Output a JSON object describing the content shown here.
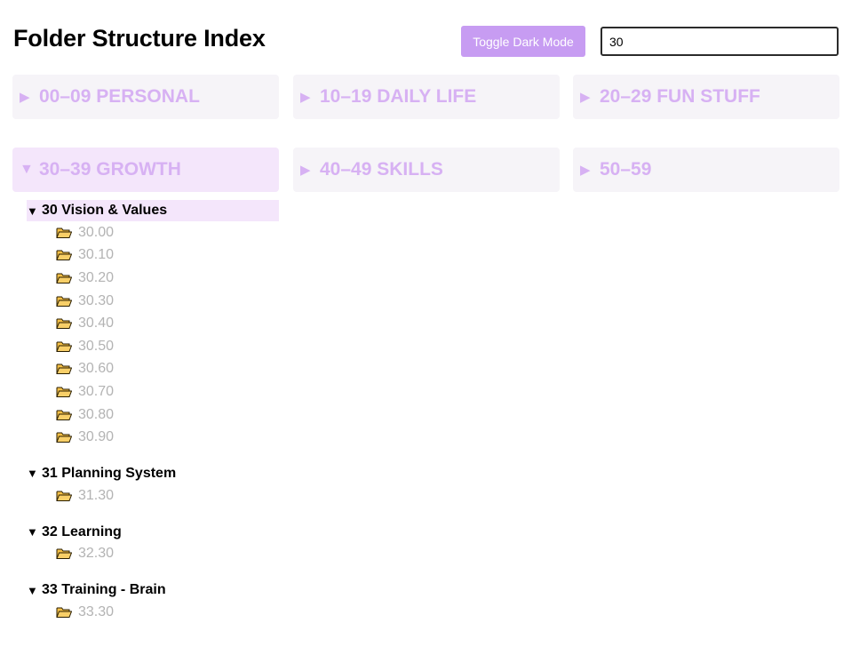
{
  "header": {
    "title": "Folder Structure Index",
    "toggle_label": "Toggle Dark Mode",
    "search_value": "30"
  },
  "colors": {
    "accent": "#c79cf2",
    "card_text": "#d7b1f3",
    "card_bg": "#f6f4f8",
    "card_open_bg": "#f4e6fb",
    "entry_text": "#b3b3b3",
    "folder_fill": "#f5c046"
  },
  "icons": {
    "collapsed": "▶",
    "expanded": "▼",
    "folder": "folder-icon"
  },
  "categories": [
    {
      "label": "00–09 PERSONAL",
      "expanded": false
    },
    {
      "label": "10–19 DAILY LIFE",
      "expanded": false
    },
    {
      "label": "20–29 FUN STUFF",
      "expanded": false
    },
    {
      "label": "30–39 GROWTH",
      "expanded": true
    },
    {
      "label": "40–49 SKILLS",
      "expanded": false
    },
    {
      "label": "50–59",
      "expanded": false
    }
  ],
  "tree": [
    {
      "title": "30 Vision & Values",
      "highlighted": true,
      "entries": [
        "30.00",
        "30.10",
        "30.20",
        "30.30",
        "30.40",
        "30.50",
        "30.60",
        "30.70",
        "30.80",
        "30.90"
      ]
    },
    {
      "title": "31 Planning System",
      "highlighted": false,
      "entries": [
        "31.30"
      ]
    },
    {
      "title": "32 Learning",
      "highlighted": false,
      "entries": [
        "32.30"
      ]
    },
    {
      "title": "33 Training - Brain",
      "highlighted": false,
      "entries": [
        "33.30"
      ]
    }
  ]
}
